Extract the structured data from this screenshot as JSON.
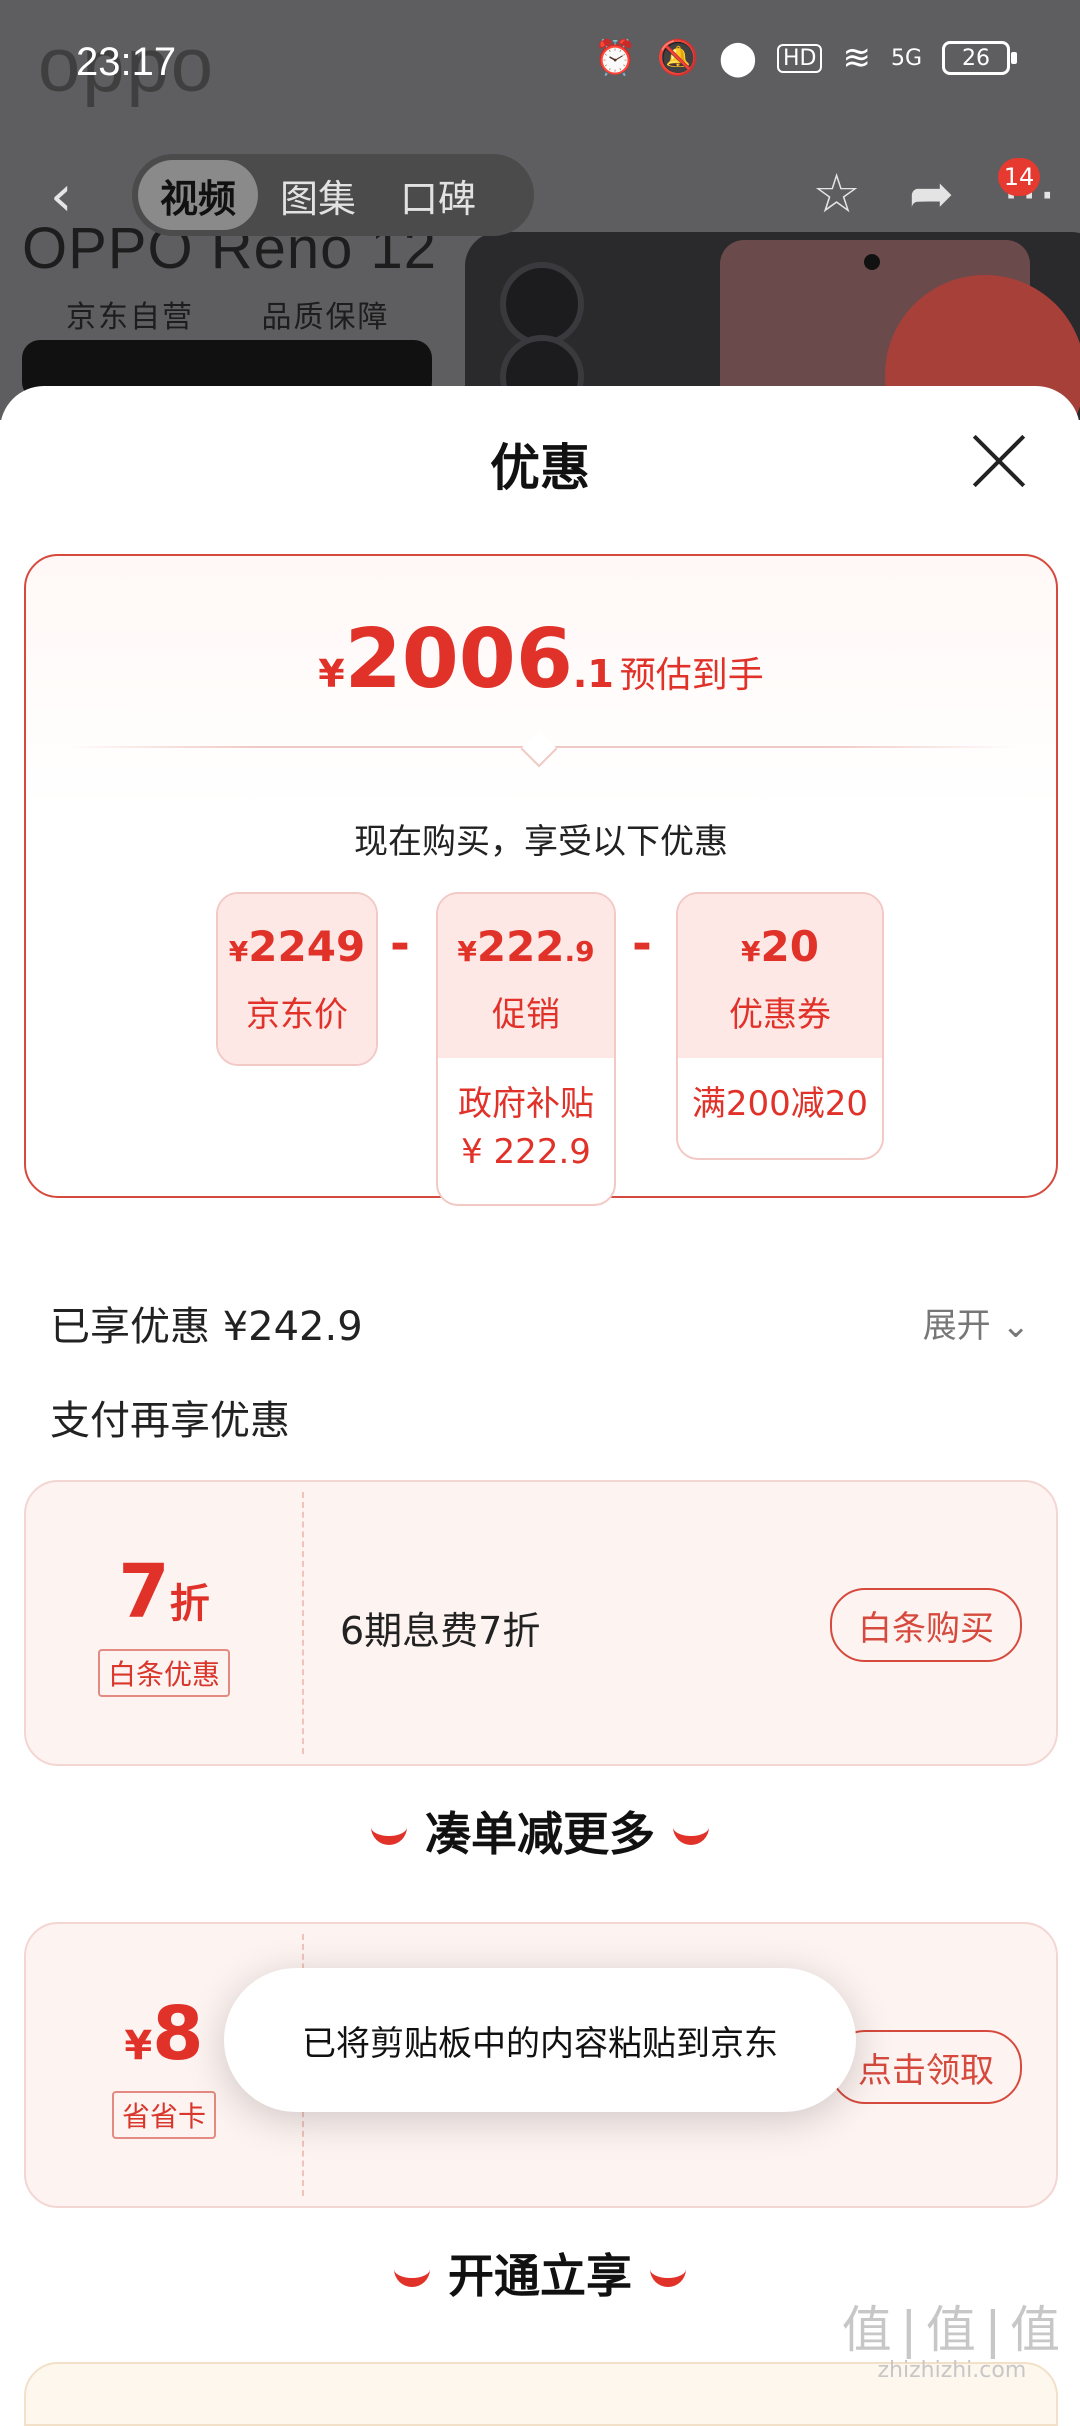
{
  "status_bar": {
    "time": "23:17",
    "battery": "26",
    "hd": "HD",
    "network": "5G"
  },
  "background": {
    "ghost_logo": "oppo",
    "product_title": "OPPO Reno 12",
    "tags": [
      "京东自营",
      "品质保障"
    ]
  },
  "top_nav": {
    "tabs": [
      "视频",
      "图集",
      "口碑"
    ],
    "active_tab": "视频",
    "cart_badge": "14"
  },
  "sheet": {
    "title": "优惠",
    "estimate": {
      "currency": "¥",
      "integer": "2006",
      "decimal": ".1",
      "label": "预估到手"
    },
    "now_buy": "现在购买，享受以下优惠",
    "breakdown": [
      {
        "amount": "2249",
        "name": "京东价"
      },
      {
        "amount": "222",
        "amount_decimal": ".9",
        "name": "促销",
        "sub_title": "政府补贴",
        "sub_value": "¥ 222.9"
      },
      {
        "amount": "20",
        "name": "优惠券",
        "sub_title": "满200减20"
      }
    ],
    "operator": "-",
    "enjoyed": "已享优惠 ¥242.9",
    "expand": "展开",
    "pay_more": "支付再享优惠",
    "baitiao": {
      "value": "7",
      "unit": "折",
      "tag": "白条优惠",
      "desc": "6期息费7折",
      "button": "白条购买"
    },
    "section_more": "凑单减更多",
    "saver": {
      "currency": "¥",
      "value": "8",
      "tag": "省省卡",
      "button": "点击领取"
    },
    "section_open": "开通立享"
  },
  "toast": "已将剪贴板中的内容粘贴到京东",
  "watermark": {
    "logo": "值|值|值",
    "site": "zhizhizhi.com"
  },
  "colors": {
    "accent": "#e1322a",
    "card_bg": "#fde8e6",
    "promo_bg": "#fdf3f1"
  }
}
